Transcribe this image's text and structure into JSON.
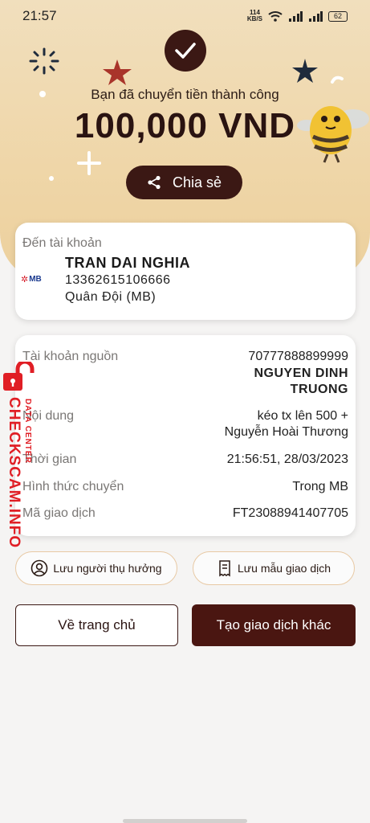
{
  "status": {
    "time": "21:57",
    "net_speed": "114",
    "net_unit": "KB/S",
    "battery": "62"
  },
  "hero": {
    "title": "Bạn đã chuyển tiền thành công",
    "amount": "100,000 VND",
    "share_label": "Chia sẻ"
  },
  "destination": {
    "label": "Đến tài khoản",
    "bank_logo": "MB",
    "name": "TRAN DAI NGHIA",
    "account": "13362615106666",
    "bank": "Quân Đội (MB)"
  },
  "details": {
    "source_label": "Tài khoản nguồn",
    "source_account": "70777888899999",
    "source_name_line1": "NGUYEN DINH",
    "source_name_line2": "TRUONG",
    "content_label": "Nội dung",
    "content_line1": "kéo tx lên 500 +",
    "content_line2": "Nguyễn Hoài Thương",
    "time_label": "Thời gian",
    "time_value": "21:56:51, 28/03/2023",
    "method_label": "Hình thức chuyển",
    "method_value": "Trong MB",
    "txid_label": "Mã giao dịch",
    "txid_value": "FT23088941407705"
  },
  "actions": {
    "save_beneficiary": "Lưu người thụ hưởng",
    "save_template": "Lưu mẫu giao dịch",
    "home": "Về trang chủ",
    "new_transaction": "Tạo giao dịch khác"
  },
  "watermark": {
    "main": "CHECKSCAM.INFO",
    "sub": "DATA CENTER"
  },
  "colors": {
    "brand_dark": "#3b1814",
    "hero_bg": "#efd6a8",
    "watermark_red": "#e01e25"
  }
}
